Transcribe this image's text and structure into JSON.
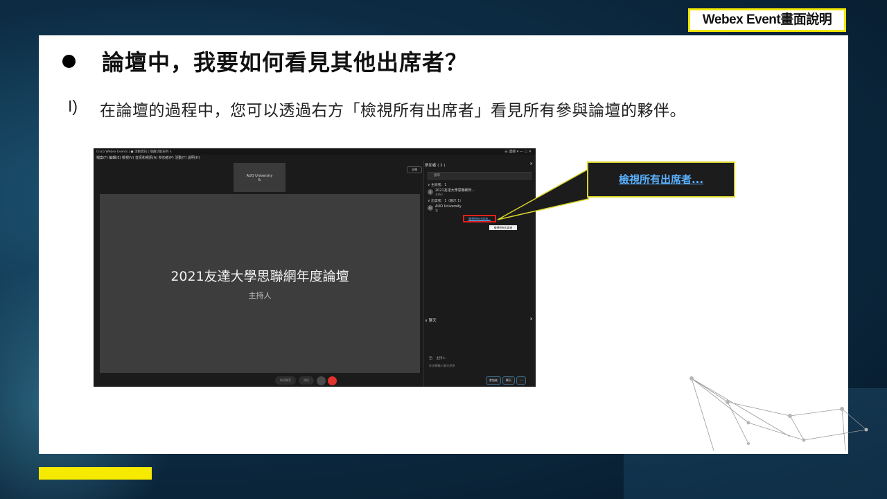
{
  "header": {
    "badge": "Webex Event畫面說明"
  },
  "slide": {
    "title": "論壇中，我要如何看見其他出席者？",
    "step_num": "I)",
    "step_text": "在論壇的過程中，您可以透過右方「檢視所有出席者」看見所有參與論壇的夥伴。"
  },
  "screenshot": {
    "titlebar_left": "Cisco Webex Events  |  ● 活動資訊  |  隱藏功能表列 ∧",
    "titlebar_right": "☰ 連線 ▾   —   ▢   ✕",
    "menubar": "檔案(F)  編輯(E)  檢視(V)  音訊和視訊(A)  參加者(P)  活動(T)  說明(H)",
    "thumb_name": "AUO University",
    "thumb_sub": "&",
    "fullscreen": "全螢",
    "main_title": "2021友達大學思聯網年度論壇",
    "main_subtitle": "主持人",
    "panel": {
      "header": "參加者 ( 2 )",
      "search": "搜尋",
      "host_group": "∨ 主辦者：1",
      "host_name": "2021友達大學思聯網年...",
      "host_role": "主持人",
      "attendee_group": "∨ 出席者：1（顯示 1）",
      "attendee_avatar": "AU",
      "attendee_name": "AUO University",
      "attendee_role": "我",
      "view_all": "檢視所有出席者...",
      "tooltip": "檢視所有出席者"
    },
    "chat": {
      "header": "∨ 聊天",
      "to_label": "至：  主持人",
      "input_placeholder": "在這裡輸入聊天訊息"
    },
    "bottom": {
      "unmute": "取消靜音",
      "video": "視訊",
      "participants_btn": "參加者",
      "chat_btn": "聊天"
    }
  },
  "callout": {
    "link": "檢視所有出席者..."
  },
  "colors": {
    "accent_yellow": "#f5ea00",
    "link_blue": "#5ab0ff",
    "highlight_red": "#e0201d"
  }
}
